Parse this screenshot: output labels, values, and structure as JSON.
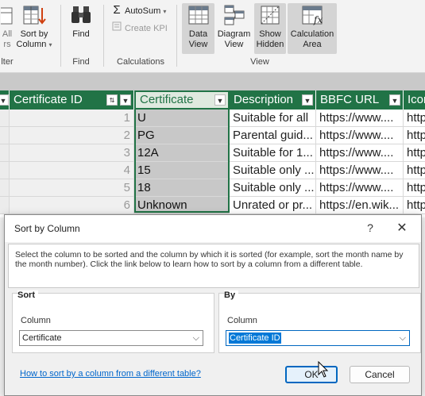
{
  "ribbon": {
    "all_label": "All",
    "all_label_2": "rs",
    "sort_label": "Sort by",
    "sort_label_2": "Column",
    "find_label": "Find",
    "autosum_label": "AutoSum",
    "create_kpi_label": "Create KPI",
    "data_view_label": "Data",
    "data_view_label_2": "View",
    "diagram_view_label": "Diagram",
    "diagram_view_label_2": "View",
    "show_hidden_label": "Show",
    "show_hidden_label_2": "Hidden",
    "calc_area_label": "Calculation",
    "calc_area_label_2": "Area",
    "groups": {
      "filter": "lter",
      "find": "Find",
      "calculations": "Calculations",
      "view": "View"
    }
  },
  "grid": {
    "headers": [
      "Certificate ID",
      "Certificate",
      "Description",
      "BBFC URL",
      "Icon"
    ],
    "rows": [
      {
        "id": "1",
        "certificate": "U",
        "description": "Suitable for all",
        "url": "https://www...."
      },
      {
        "id": "2",
        "certificate": "PG",
        "description": "Parental guid...",
        "url": "https://www...."
      },
      {
        "id": "3",
        "certificate": "12A",
        "description": "Suitable for 1...",
        "url": "https://www...."
      },
      {
        "id": "4",
        "certificate": "15",
        "description": "Suitable only ...",
        "url": "https://www...."
      },
      {
        "id": "5",
        "certificate": "18",
        "description": "Suitable only ...",
        "url": "https://www...."
      },
      {
        "id": "6",
        "certificate": "Unknown",
        "description": "Unrated or pr...",
        "url": "https://en.wik..."
      }
    ],
    "icon_cell": "http"
  },
  "dialog": {
    "title": "Sort by Column",
    "help": "?",
    "description": "Select the column to be sorted and the column by which it is sorted (for example, sort the month name by the month number). Click the link below to learn how to sort by a column from a different table.",
    "sort": {
      "title": "Sort",
      "column_label": "Column",
      "value": "Certificate"
    },
    "by": {
      "title": "By",
      "column_label": "Column",
      "value": "Certificate ID"
    },
    "link": "How to sort by a column from a different table?",
    "ok": "OK",
    "cancel": "Cancel"
  },
  "colors": {
    "accent": "#217346",
    "link": "#0066cc",
    "focus": "#0067c0"
  }
}
